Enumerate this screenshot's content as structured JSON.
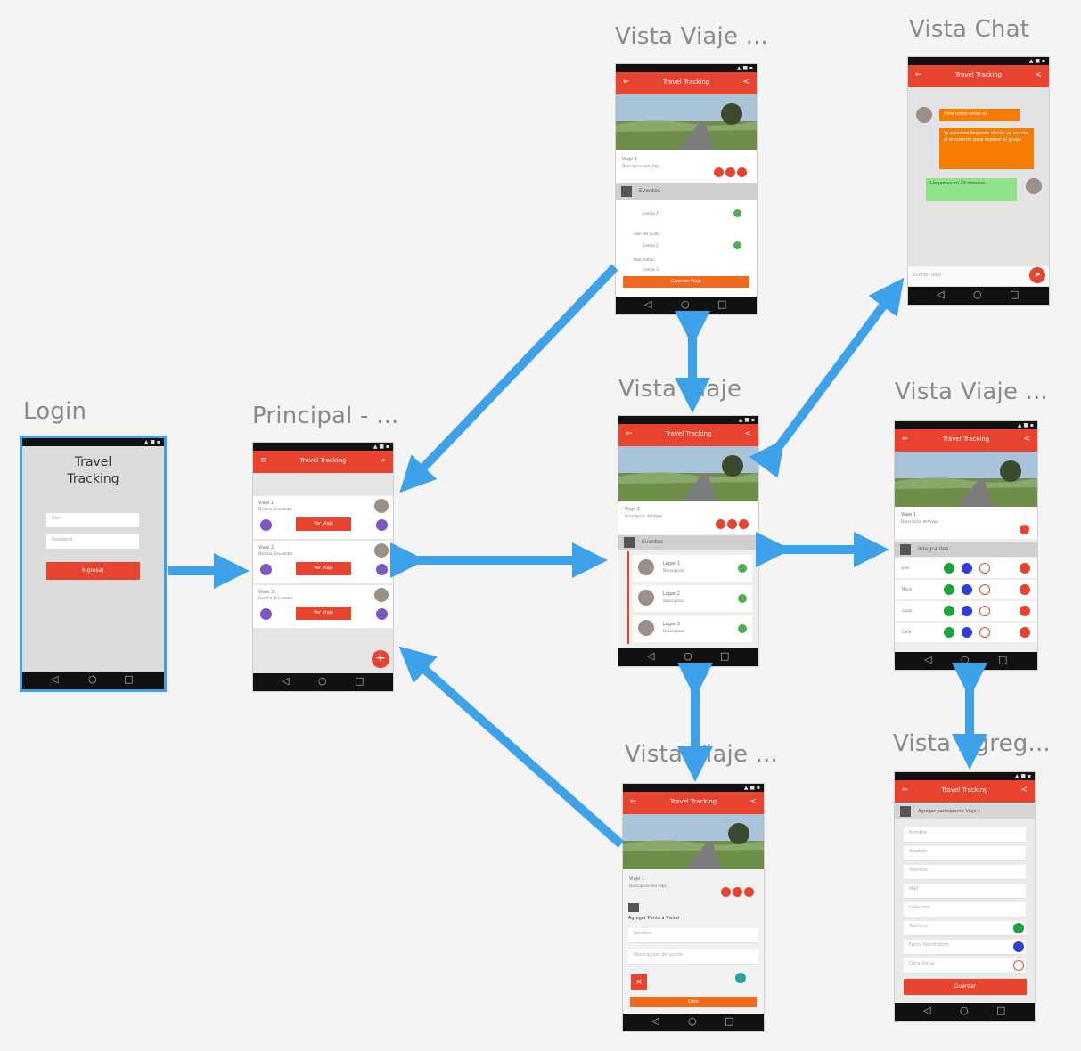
{
  "titles": {
    "login": "Login",
    "principal": "Principal - ...",
    "viaje_top": "Vista Viaje ...",
    "chat": "Vista Chat",
    "viaje_center": "Vista Viaje",
    "viaje_right": "Vista Viaje ...",
    "viaje_bottom": "Vista Viaje ...",
    "agregar": "Vista Agreg..."
  },
  "login": {
    "app_title": "Travel Tracking",
    "user_placeholder": "User",
    "password_placeholder": "Password",
    "button_label": "Ingresar"
  },
  "app_bar_title": "Travel Tracking",
  "principal": {
    "trips": [
      {
        "name": "Viaje 1",
        "sub": "Destino, Encuentro",
        "button": "Ver Viaje"
      },
      {
        "name": "Viaje 2",
        "sub": "Destino, Encuentro",
        "button": "Ver Viaje"
      },
      {
        "name": "Viaje 3",
        "sub": "Destino, Encuentro",
        "button": "Ver Viaje"
      }
    ]
  },
  "trip": {
    "name": "Viaje 1",
    "sub": "Descripcion del Viaje",
    "section_events": "Eventos",
    "section_people": "Integrantes"
  },
  "viaje_top": {
    "items": [
      "Evento 1",
      "Salir del punto",
      "Evento 2",
      "Rest station",
      "Evento 3"
    ],
    "button": "Guardar Viaje"
  },
  "viaje_center": {
    "items": [
      {
        "name": "Lugar 1",
        "sub": "Descripcion"
      },
      {
        "name": "Lugar 2",
        "sub": "Descripcion"
      },
      {
        "name": "Lugar 3",
        "sub": "Descripcion"
      }
    ]
  },
  "viaje_right": {
    "members": [
      "Juan",
      "Maria",
      "Lucas",
      "Carla"
    ]
  },
  "viaje_bottom": {
    "section": "Agregar Punto a Visitar",
    "field1": "Nombre",
    "field2": "Descripcion del punto",
    "button": "Listo"
  },
  "chat": {
    "messages": [
      {
        "side": "left",
        "text": "Hola como estan el"
      },
      {
        "side": "left",
        "text": "Ya estamos llegando donde se acordo el encuentro para esperar al grupo"
      },
      {
        "side": "right",
        "text": "Llegamos en 10 minutos"
      }
    ],
    "input_placeholder": "Escribir aqui"
  },
  "agregar": {
    "section": "Agregar participante Viaje 1",
    "fields": [
      "Nombre",
      "Apellido",
      "Telefono",
      "Mail",
      "Direccion",
      "Telefono",
      "Fecha Nacimiento",
      "Obra Social"
    ],
    "button": "Guardar"
  },
  "colors": {
    "accent": "#e8432e",
    "arrow": "#3da2ea",
    "chat_orange": "#f57c00",
    "chat_green": "#8fe28a",
    "purple": "#7e57c2"
  }
}
